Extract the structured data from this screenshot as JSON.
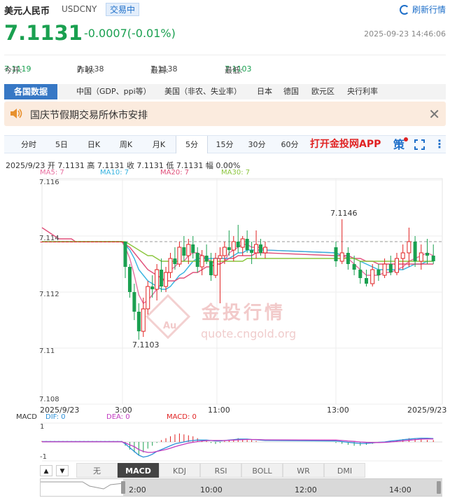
{
  "header": {
    "name": "美元人民币",
    "code": "USDCNY",
    "status_badge": "交易中",
    "refresh_label": "刷新行情"
  },
  "quote": {
    "price": "7.1131",
    "change": "-0.0007(-0.01%)",
    "timestamp": "2025-09-23 14:46:06"
  },
  "stats": {
    "open_label": "今开:",
    "open": "7.1119",
    "prev_close_label": "昨收:",
    "prev_close": "7.1138",
    "high_label": "最高:",
    "high": "7.1138",
    "low_label": "最低:",
    "low": "7.1103"
  },
  "data_tabs": [
    {
      "label": "各国数据",
      "active": true
    },
    {
      "label": "中国（GDP、ppi等）"
    },
    {
      "label": "美国（非农、失业率）"
    },
    {
      "label": "日本"
    },
    {
      "label": "德国"
    },
    {
      "label": "欧元区"
    },
    {
      "label": "央行利率"
    }
  ],
  "notice": {
    "text": "国庆节假期交易所休市安排",
    "close_symbol": "✕"
  },
  "periods": [
    {
      "label": "分时"
    },
    {
      "label": "5日"
    },
    {
      "label": "日K"
    },
    {
      "label": "周K"
    },
    {
      "label": "月K"
    },
    {
      "label": "5分",
      "active": true
    },
    {
      "label": "15分"
    },
    {
      "label": "30分"
    },
    {
      "label": "60分"
    }
  ],
  "period_bar": {
    "app_label": "打开金投网APP",
    "strategy_label": "策",
    "more_icon": "⋮"
  },
  "candle_info": "2025/9/23  开 7.1131  高 7.1131  收 7.1131  低 7.1131  幅 0.00%",
  "ma_legend": [
    {
      "label": "MA5: 7",
      "color": "#e86fa0"
    },
    {
      "label": "MA10: 7",
      "color": "#35b3e0"
    },
    {
      "label": "MA20: 7",
      "color": "#e0507a"
    },
    {
      "label": "MA30: 7",
      "color": "#8cc63e"
    }
  ],
  "watermark": {
    "brand": "金投行情",
    "url": "quote.cngold.org",
    "logo_text": "Au"
  },
  "macd_legend": {
    "title": "MACD",
    "dif": "DIF: 0",
    "dif_color": "#2a8fd8",
    "dea": "DEA: 0",
    "dea_color": "#c03bc0",
    "macd": "MACD: 0",
    "macd_color": "#e02222"
  },
  "macd_axis": {
    "top": "1",
    "bottom": "-1"
  },
  "indicator_arrows": {
    "up": "▲",
    "down": "▼"
  },
  "indicators": [
    {
      "label": "无"
    },
    {
      "label": "MACD",
      "active": true
    },
    {
      "label": "KDJ"
    },
    {
      "label": "RSI"
    },
    {
      "label": "BOLL"
    },
    {
      "label": "WR"
    },
    {
      "label": "DMI"
    }
  ],
  "navigator_times": [
    "2:00",
    "10:00",
    "12:00",
    "14:00"
  ],
  "chart_data": {
    "type": "candlestick",
    "y_ticks": [
      "7.116",
      "7.114",
      "7.112",
      "7.11",
      "7.108"
    ],
    "ylim": [
      7.108,
      7.116
    ],
    "x_ticks": [
      "2025/9/23",
      "3:00",
      "11:00",
      "13:00",
      "2025/9/23"
    ],
    "annotations": [
      {
        "text": "7.1146",
        "value": 7.1146
      },
      {
        "text": "7.1103",
        "value": 7.1103
      }
    ],
    "reference_line": 7.1138,
    "colors": {
      "up": "#e02222",
      "down": "#1aa050"
    },
    "candles": [
      [
        7.1138,
        7.1138,
        7.1138,
        7.1138
      ],
      [
        7.1138,
        7.1138,
        7.1138,
        7.1138
      ],
      [
        7.1138,
        7.1138,
        7.1138,
        7.1138
      ],
      [
        7.1138,
        7.1138,
        7.1138,
        7.1138
      ],
      [
        7.1138,
        7.1138,
        7.1138,
        7.1138
      ],
      [
        7.1138,
        7.1138,
        7.1138,
        7.1138
      ],
      [
        7.1138,
        7.1138,
        7.1138,
        7.1138
      ],
      [
        7.1138,
        7.1138,
        7.1138,
        7.1138
      ],
      [
        7.1138,
        7.1138,
        7.1138,
        7.1138
      ],
      [
        7.1138,
        7.1138,
        7.1138,
        7.1138
      ],
      [
        7.1138,
        7.1138,
        7.1138,
        7.1138
      ],
      [
        7.1138,
        7.1138,
        7.1138,
        7.1138
      ],
      [
        7.1138,
        7.1138,
        7.1138,
        7.1138
      ],
      [
        7.1138,
        7.1138,
        7.1138,
        7.1138
      ],
      [
        7.1138,
        7.1138,
        7.1138,
        7.1138
      ],
      [
        7.1138,
        7.1138,
        7.1138,
        7.1138
      ],
      [
        7.1138,
        7.1138,
        7.1138,
        7.1138
      ],
      [
        7.1138,
        7.1138,
        7.1138,
        7.1138
      ],
      [
        7.1138,
        7.1138,
        7.1138,
        7.1138
      ],
      [
        7.1138,
        7.1138,
        7.1138,
        7.1138
      ],
      [
        7.1138,
        7.1138,
        7.1125,
        7.1129
      ],
      [
        7.1129,
        7.113,
        7.1118,
        7.112
      ],
      [
        7.112,
        7.1123,
        7.111,
        7.1113
      ],
      [
        7.1113,
        7.1116,
        7.1103,
        7.1106
      ],
      [
        7.1106,
        7.1118,
        7.1104,
        7.1114
      ],
      [
        7.1114,
        7.1124,
        7.1112,
        7.1122
      ],
      [
        7.1122,
        7.1126,
        7.1118,
        7.1121
      ],
      [
        7.1121,
        7.113,
        7.1117,
        7.1128
      ],
      [
        7.1128,
        7.1132,
        7.112,
        7.1122
      ],
      [
        7.1122,
        7.1129,
        7.112,
        7.1127
      ],
      [
        7.1127,
        7.1134,
        7.1125,
        7.1132
      ],
      [
        7.1132,
        7.1136,
        7.1128,
        7.113
      ],
      [
        7.113,
        7.1138,
        7.1129,
        7.1136
      ],
      [
        7.1136,
        7.114,
        7.1131,
        7.1133
      ],
      [
        7.1133,
        7.1139,
        7.113,
        7.1137
      ],
      [
        7.1137,
        7.114,
        7.1132,
        7.1134
      ],
      [
        7.1134,
        7.1136,
        7.1127,
        7.1129
      ],
      [
        7.1129,
        7.1135,
        7.1126,
        7.1133
      ],
      [
        7.1133,
        7.1137,
        7.113,
        7.1131
      ],
      [
        7.1131,
        7.1134,
        7.1124,
        7.1126
      ],
      [
        7.1126,
        7.1134,
        7.1125,
        7.1132
      ],
      [
        7.1132,
        7.1136,
        7.1116,
        7.1133
      ],
      [
        7.1133,
        7.1138,
        7.113,
        7.1136
      ],
      [
        7.1136,
        7.1142,
        7.1133,
        7.1135
      ],
      [
        7.1135,
        7.114,
        7.1131,
        7.1138
      ],
      [
        7.1138,
        7.1144,
        7.1134,
        7.1136
      ],
      [
        7.1136,
        7.114,
        7.1133,
        7.1139
      ],
      [
        7.1139,
        7.1142,
        7.1134,
        7.1135
      ],
      [
        7.1135,
        7.1138,
        7.113,
        7.1134
      ],
      [
        7.1134,
        7.1142,
        7.1132,
        7.1137
      ],
      [
        7.1137,
        7.1139,
        7.1133,
        7.1134
      ],
      [
        7.1134,
        7.1138,
        7.1132,
        7.1136
      ],
      [
        7.1136,
        7.1138,
        7.1129,
        7.1131
      ],
      [
        7.1131,
        7.1146,
        7.113,
        7.1134
      ],
      [
        7.1134,
        7.1136,
        7.1128,
        7.113
      ],
      [
        7.113,
        7.1133,
        7.1126,
        7.1128
      ],
      [
        7.1128,
        7.1131,
        7.1123,
        7.1125
      ],
      [
        7.1125,
        7.1128,
        7.1122,
        7.1123
      ],
      [
        7.1123,
        7.113,
        7.1122,
        7.1128
      ],
      [
        7.1128,
        7.113,
        7.1124,
        7.1126
      ],
      [
        7.1126,
        7.1132,
        7.1125,
        7.113
      ],
      [
        7.113,
        7.1133,
        7.1126,
        7.1127
      ],
      [
        7.1127,
        7.1134,
        7.1126,
        7.1132
      ],
      [
        7.1132,
        7.1137,
        7.1128,
        7.1134
      ],
      [
        7.1134,
        7.1143,
        7.1129,
        7.1138
      ],
      [
        7.1138,
        7.114,
        7.1129,
        7.1131
      ],
      [
        7.1131,
        7.1137,
        7.1128,
        7.1134
      ],
      [
        7.1134,
        7.1139,
        7.113,
        7.1133
      ],
      [
        7.1133,
        7.1137,
        7.113,
        7.1131
      ]
    ],
    "ma5": [
      7.1138,
      7.1138,
      7.1138,
      7.1138,
      7.1138,
      7.1138,
      7.1138,
      7.1138,
      7.1138,
      7.1138,
      7.1138,
      7.1138,
      7.1138,
      7.1138,
      7.1138,
      7.1138,
      7.1138,
      7.1138,
      7.1138,
      7.1138,
      7.1136,
      7.1132,
      7.1126,
      7.1119,
      7.1116,
      7.1117,
      7.1119,
      7.1121,
      7.1123,
      7.1126,
      7.1128,
      7.1129,
      7.1131,
      7.1131,
      7.1133,
      7.1134,
      7.1134,
      7.1133,
      7.1132,
      7.1131,
      7.113,
      7.113,
      7.1131,
      7.1134,
      7.1135,
      7.1136,
      7.1137,
      7.1137,
      7.1136,
      7.1136,
      7.1136,
      7.1135,
      7.1134,
      7.1133,
      7.1132,
      7.113,
      7.1128,
      7.1126,
      7.1126,
      7.1126,
      7.1127,
      7.1127,
      7.1128,
      7.1129,
      7.1131,
      7.1132,
      7.1133,
      7.1134,
      7.1133
    ],
    "ma10": [
      7.1138,
      7.1138,
      7.1138,
      7.1138,
      7.1138,
      7.1138,
      7.1138,
      7.1138,
      7.1138,
      7.1138,
      7.1138,
      7.1138,
      7.1138,
      7.1138,
      7.1138,
      7.1138,
      7.1138,
      7.1138,
      7.1138,
      7.1138,
      7.1137,
      7.1135,
      7.1132,
      7.1128,
      7.1126,
      7.1124,
      7.1123,
      7.1122,
      7.1121,
      7.1121,
      7.1122,
      7.1124,
      7.1126,
      7.1127,
      7.1129,
      7.1131,
      7.1132,
      7.1132,
      7.1132,
      7.1132,
      7.1132,
      7.1132,
      7.1132,
      7.1132,
      7.1133,
      7.1134,
      7.1134,
      7.1135,
      7.1135,
      7.1135,
      7.1135,
      7.1135,
      7.1134,
      7.1133,
      7.1133,
      7.1132,
      7.1131,
      7.113,
      7.1129,
      7.1128,
      7.1128,
      7.1128,
      7.1128,
      7.1128,
      7.1129,
      7.113,
      7.113,
      7.1131,
      7.1131
    ],
    "ma20": [
      7.1143,
      7.1142,
      7.1141,
      7.114,
      7.1139,
      7.1139,
      7.1139,
      7.1139,
      7.1138,
      7.1138,
      7.1138,
      7.1138,
      7.1138,
      7.1138,
      7.1138,
      7.1138,
      7.1138,
      7.1138,
      7.1138,
      7.1138,
      7.1137,
      7.1136,
      7.1134,
      7.1132,
      7.113,
      7.1128,
      7.1127,
      7.1126,
      7.1125,
      7.1124,
      7.1124,
      7.1124,
      7.1125,
      7.1125,
      7.1126,
      7.1127,
      7.1127,
      7.1128,
      7.1129,
      7.1129,
      7.113,
      7.113,
      7.1131,
      7.1132,
      7.1132,
      7.1133,
      7.1133,
      7.1133,
      7.1133,
      7.1134,
      7.1134,
      7.1134,
      7.1133,
      7.1133,
      7.1133,
      7.1132,
      7.1132,
      7.1131,
      7.1131,
      7.113,
      7.113,
      7.113,
      7.113,
      7.113,
      7.113,
      7.113,
      7.113,
      7.113,
      7.113
    ],
    "ma30": [
      7.1138,
      7.1138,
      7.1138,
      7.1138,
      7.1138,
      7.1138,
      7.1138,
      7.1138,
      7.1138,
      7.1138,
      7.1138,
      7.1138,
      7.1138,
      7.1138,
      7.1138,
      7.1138,
      7.1138,
      7.1138,
      7.1138,
      7.1138,
      7.1138,
      7.1137,
      7.1136,
      7.1135,
      7.1134,
      7.1133,
      7.1133,
      7.1132,
      7.1131,
      7.1131,
      7.1131,
      7.1131,
      7.1131,
      7.1131,
      7.1131,
      7.1131,
      7.1131,
      7.1131,
      7.1131,
      7.1131,
      7.1131,
      7.1131,
      7.1131,
      7.1131,
      7.1131,
      7.1131,
      7.1131,
      7.1132,
      7.1132,
      7.1132,
      7.1132,
      7.1132,
      7.1132,
      7.1132,
      7.1132,
      7.1132,
      7.1131,
      7.1131,
      7.1131,
      7.1131,
      7.1131,
      7.1131,
      7.1131,
      7.1131,
      7.1131,
      7.1131,
      7.1131,
      7.1131,
      7.1131
    ],
    "macd": {
      "ylim": [
        -1,
        1
      ],
      "hist": [
        0.05,
        0.05,
        0.05,
        0.05,
        0.05,
        0.05,
        0.05,
        0.05,
        0.05,
        0.05,
        0.05,
        0.05,
        0.05,
        0.05,
        0.05,
        0.05,
        0.05,
        0.05,
        0.05,
        0.05,
        -0.2,
        -0.4,
        -0.55,
        -0.7,
        -0.55,
        -0.35,
        -0.2,
        -0.05,
        0.1,
        0.2,
        0.3,
        0.4,
        0.45,
        0.4,
        0.35,
        0.3,
        0.2,
        0.1,
        0.05,
        -0.05,
        -0.1,
        -0.05,
        0.05,
        0.1,
        0.15,
        0.2,
        0.15,
        0.1,
        0.1,
        0.05,
        0.0,
        0.0,
        -0.05,
        -0.1,
        -0.15,
        -0.2,
        -0.2,
        -0.15,
        -0.1,
        -0.05,
        0.0,
        0.05,
        0.1,
        0.15,
        0.2,
        0.2,
        0.15,
        0.1,
        0.1
      ],
      "dif": [
        0.02,
        0.02,
        0.02,
        0.02,
        0.02,
        0.02,
        0.02,
        0.02,
        0.02,
        0.02,
        0.02,
        0.02,
        0.02,
        0.02,
        0.02,
        0.02,
        0.02,
        0.02,
        0.02,
        0.02,
        -0.1,
        -0.3,
        -0.5,
        -0.7,
        -0.8,
        -0.75,
        -0.65,
        -0.5,
        -0.4,
        -0.3,
        -0.2,
        -0.1,
        -0.05,
        0.0,
        0.05,
        0.08,
        0.1,
        0.1,
        0.1,
        0.08,
        0.05,
        0.05,
        0.08,
        0.1,
        0.12,
        0.15,
        0.15,
        0.15,
        0.13,
        0.12,
        0.1,
        0.08,
        0.05,
        0.02,
        -0.02,
        -0.05,
        -0.08,
        -0.08,
        -0.05,
        -0.02,
        0.0,
        0.05,
        0.08,
        0.12,
        0.15,
        0.18,
        0.2,
        0.2,
        0.18
      ],
      "dea": [
        0.01,
        0.01,
        0.01,
        0.01,
        0.01,
        0.01,
        0.01,
        0.01,
        0.01,
        0.01,
        0.01,
        0.01,
        0.01,
        0.01,
        0.01,
        0.01,
        0.01,
        0.01,
        0.01,
        0.01,
        -0.05,
        -0.15,
        -0.25,
        -0.4,
        -0.5,
        -0.55,
        -0.55,
        -0.5,
        -0.45,
        -0.4,
        -0.33,
        -0.25,
        -0.18,
        -0.12,
        -0.06,
        -0.02,
        0.02,
        0.05,
        0.07,
        0.08,
        0.08,
        0.08,
        0.08,
        0.09,
        0.1,
        0.11,
        0.12,
        0.13,
        0.13,
        0.13,
        0.12,
        0.11,
        0.1,
        0.08,
        0.05,
        0.03,
        0.0,
        -0.02,
        -0.03,
        -0.03,
        -0.02,
        0.0,
        0.03,
        0.06,
        0.09,
        0.12,
        0.15,
        0.16,
        0.16
      ]
    }
  }
}
